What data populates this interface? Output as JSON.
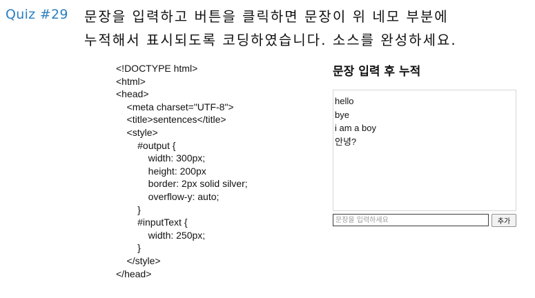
{
  "quiz": {
    "label": "Quiz #29",
    "line1": "문장을 입력하고 버튼을 클릭하면 문장이 위 네모 부분에",
    "line2": "누적해서 표시되도록 코딩하였습니다. 소스를 완성하세요."
  },
  "code": [
    "<!DOCTYPE html>",
    "<html>",
    "<head>",
    "    <meta charset=\"UTF-8\">",
    "    <title>sentences</title>",
    "    <style>",
    "        #output {",
    "            width: 300px;",
    "            height: 200px",
    "            border: 2px solid silver;",
    "            overflow-y: auto;",
    "        }",
    "        #inputText {",
    "            width: 250px;",
    "        }",
    "    </style>",
    "</head>"
  ],
  "demo": {
    "heading": "문장 입력 후 누적",
    "output_lines": [
      "hello",
      "bye",
      "i am a boy",
      "안녕?"
    ],
    "input_placeholder": "문장을 입력하세요",
    "input_value": "",
    "button_label": "추가"
  }
}
